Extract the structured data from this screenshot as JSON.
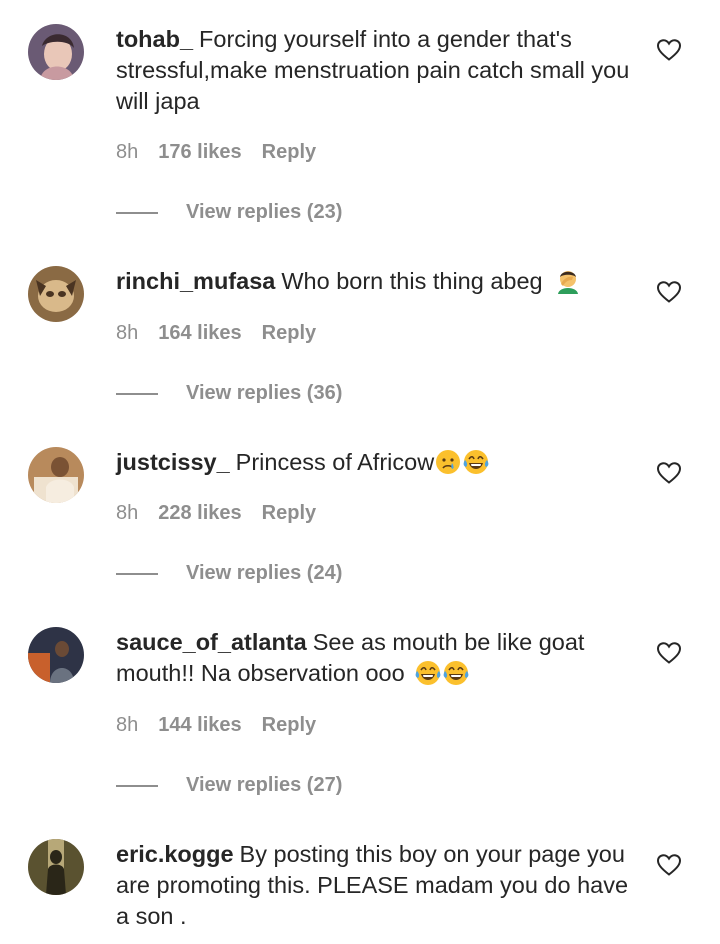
{
  "comments": [
    {
      "username": "tohab_",
      "text": "Forcing yourself into a gender that's stressful,make menstruation pain catch small you will japa",
      "emoji": [],
      "time": "8h",
      "likes": "176 likes",
      "reply_label": "Reply",
      "view_replies": "View replies (23)",
      "avatar_colors": [
        "#6a5a74",
        "#c89aa0",
        "#e9c7b8"
      ]
    },
    {
      "username": "rinchi_mufasa",
      "text": "Who born this thing abeg",
      "emoji": [
        "man-facepalming"
      ],
      "time": "8h",
      "likes": "164 likes",
      "reply_label": "Reply",
      "view_replies": "View replies (36)",
      "avatar_colors": [
        "#8a6a44",
        "#d9b98a",
        "#4a3422"
      ]
    },
    {
      "username": "justcissy_",
      "text": "Princess of Africow",
      "emoji": [
        "crying-face",
        "tears-of-joy"
      ],
      "time": "8h",
      "likes": "228 likes",
      "reply_label": "Reply",
      "view_replies": "View replies (24)",
      "avatar_colors": [
        "#b88a5c",
        "#efe2cf",
        "#7a5234"
      ]
    },
    {
      "username": "sauce_of_atlanta",
      "text": "See as mouth be like goat mouth!! Na observation ooo",
      "emoji": [
        "tears-of-joy",
        "tears-of-joy"
      ],
      "time": "8h",
      "likes": "144 likes",
      "reply_label": "Reply",
      "view_replies": "View replies (27)",
      "avatar_colors": [
        "#2e3346",
        "#c8602c",
        "#6a7280"
      ]
    },
    {
      "username": "eric.kogge",
      "text": "By posting this boy on your page you are promoting this. PLEASE madam you do have a son .",
      "emoji": [],
      "avatar_colors": [
        "#5a5230",
        "#b7a878",
        "#2a2618"
      ]
    }
  ]
}
